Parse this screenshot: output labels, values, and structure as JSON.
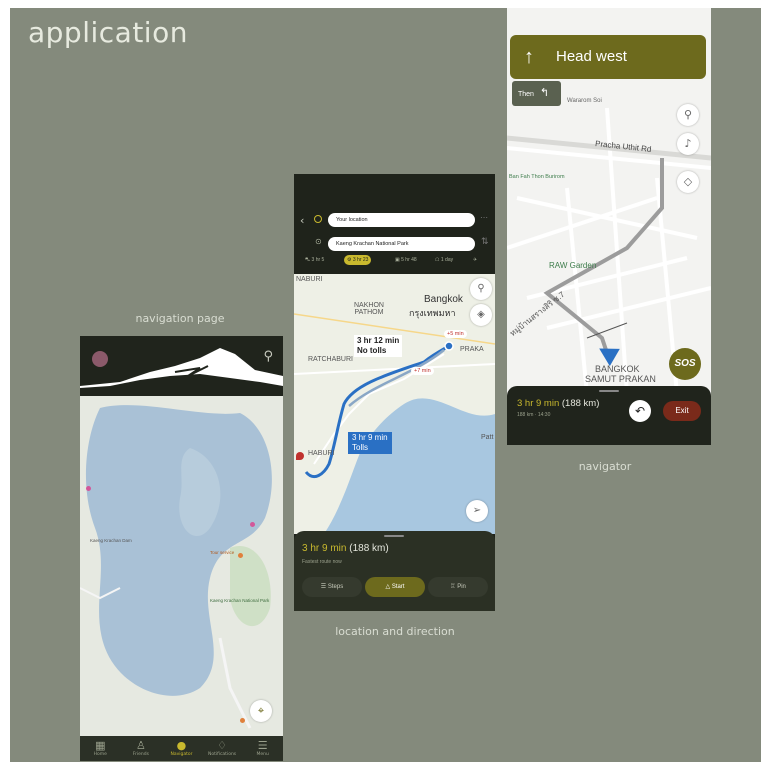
{
  "page": {
    "title": "application"
  },
  "captions": {
    "navigation_page": "navigation page",
    "location_direction": "location and direction",
    "navigator": "navigator"
  },
  "colors": {
    "board": "#848a7c",
    "accent": "#c9b92e",
    "dark": "#20241c",
    "banner": "#6d6a1d",
    "exit": "#7a2a1a"
  },
  "nav_page": {
    "labels": [
      "Kaeng Krachan Dam",
      "Kaeng Krachan National Park",
      "Tour service"
    ],
    "tabs": [
      {
        "icon": "grid-icon",
        "label": "Home"
      },
      {
        "icon": "people-icon",
        "label": "Friends"
      },
      {
        "icon": "pin-icon",
        "label": "Navigator"
      },
      {
        "icon": "bell-icon",
        "label": "Notifications"
      },
      {
        "icon": "menu-icon",
        "label": "Menu"
      }
    ]
  },
  "direction_page": {
    "origin": "Your location",
    "destination": "Kaeng Krachan National Park",
    "modes": [
      "3 hr 5",
      "3 hr 23",
      "5 hr 48",
      "1 day"
    ],
    "map_labels": {
      "naburi": "NABURI",
      "nakhon": "NAKHON\nPATHOM",
      "bangkok": "Bangkok",
      "bangkok_th": "กรุงเทพมหา",
      "ratchaburi": "RATCHABURI",
      "phetchaburi": "HABURI",
      "prakan": "PRAKA",
      "patt": "Patt"
    },
    "callouts": {
      "alt1_time": "3 hr 12 min",
      "alt1_note": "No tolls",
      "best_time": "3 hr 9 min",
      "best_note": "Tolls",
      "plus5": "+5 min",
      "plus7": "+7 min"
    },
    "summary": {
      "time": "3 hr 9 min",
      "distance": "(188 km)",
      "note": "Fastest route now"
    },
    "buttons": {
      "steps": "Steps",
      "start": "Start",
      "pin": "Pin"
    }
  },
  "navigator_page": {
    "instruction": "Head west",
    "then_label": "Then",
    "map_labels": {
      "wararom": "Wararom Soi",
      "pracha": "Pracha Uthit Rd",
      "banfah": "Ban Fah Thon Burirom",
      "raw": "RAW Garden",
      "thai_road": "หมู่บ้านสรางสิริ ซ.7",
      "bangkok": "BANGKOK",
      "samut": "SAMUT PRAKAN"
    },
    "sos": "SOS",
    "summary": {
      "time": "3 hr 9 min",
      "distance": "(188 km)",
      "sub": "188 km · 14:30"
    },
    "exit": "Exit"
  }
}
